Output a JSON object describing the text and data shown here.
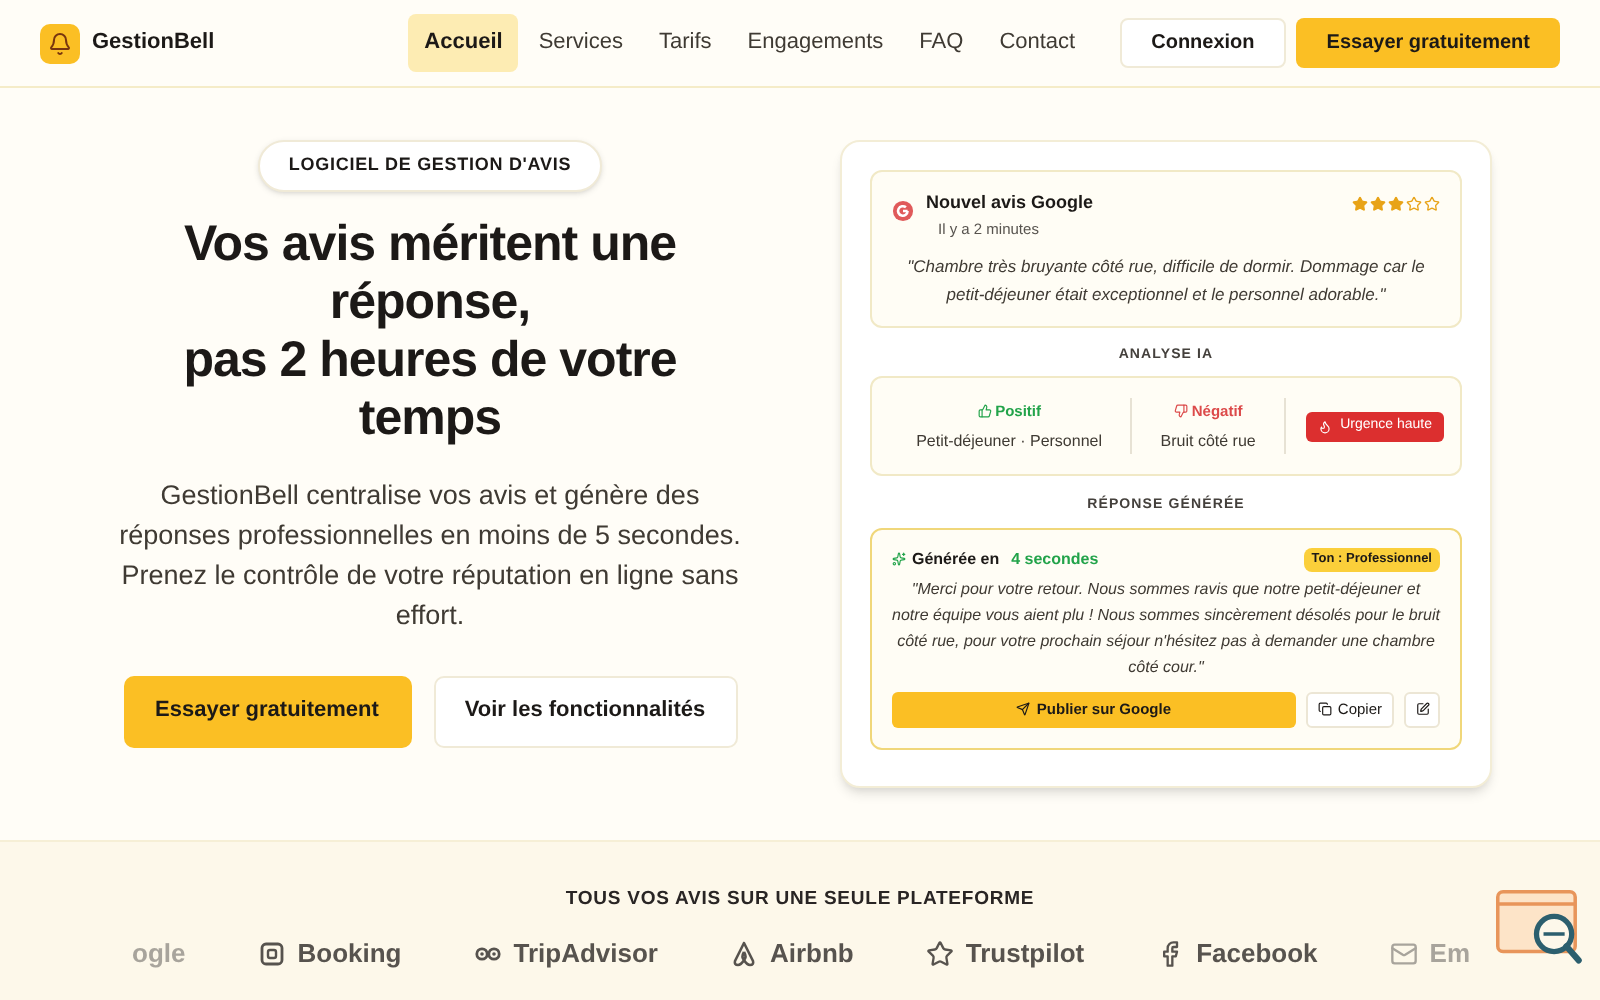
{
  "nav": {
    "brand": "GestionBell",
    "links": [
      {
        "label": "Accueil",
        "selected": true
      },
      {
        "label": "Services",
        "selected": false
      },
      {
        "label": "Tarifs",
        "selected": false
      },
      {
        "label": "Engagements",
        "selected": false
      },
      {
        "label": "FAQ",
        "selected": false
      },
      {
        "label": "Contact",
        "selected": false
      }
    ],
    "login": "Connexion",
    "cta": "Essayer gratuitement"
  },
  "hero": {
    "badge": "LOGICIEL DE GESTION D'AVIS",
    "title_lines": [
      "Vos avis méritent une réponse,",
      "pas 2 heures de votre temps"
    ],
    "text": "GestionBell centralise vos avis et génère des réponses professionnelles en moins de 5 secondes. Prenez le contrôle de votre réputation en ligne sans effort.",
    "primary": "Essayer gratuitement",
    "secondary": "Voir les fonctionnalités"
  },
  "demo": {
    "review": {
      "title": "Nouvel avis Google",
      "time": "Il y a 2 minutes",
      "stars": 3,
      "text": "\"Chambre très bruyante côté rue, difficile de dormir. Dommage car le petit-déjeuner était exceptionnel et le personnel adorable.\""
    },
    "analysis_title": "ANALYSE IA",
    "analysis": {
      "positive_label": "Positif",
      "positive": "Petit-déjeuner · Personnel",
      "negative_label": "Négatif",
      "negative": "Bruit côté rue",
      "urgency": "Urgence haute"
    },
    "response_title": "RÉPONSE GÉNÉRÉE",
    "response": {
      "generated": "Générée en",
      "duration": "4 secondes",
      "tone": "Ton : Professionnel",
      "text": "\"Merci pour votre retour. Nous sommes ravis que notre petit-déjeuner et notre équipe vous aient plu ! Nous sommes sincèrement désolés pour le bruit côté rue, pour votre prochain séjour n'hésitez pas à demander une chambre côté cour.\"",
      "publish": "Publier sur Google",
      "copy": "Copier"
    }
  },
  "platforms": {
    "title": "TOUS VOS AVIS SUR UNE SEULE PLATEFORME",
    "items": [
      {
        "kind": "google",
        "label": "ogle",
        "faded": true
      },
      {
        "kind": "booking",
        "label": "Booking",
        "faded": false
      },
      {
        "kind": "tripadvisor",
        "label": "TripAdvisor",
        "faded": false
      },
      {
        "kind": "airbnb",
        "label": "Airbnb",
        "faded": false
      },
      {
        "kind": "trustpilot",
        "label": "Trustpilot",
        "faded": false
      },
      {
        "kind": "facebook",
        "label": "Facebook",
        "faded": false
      },
      {
        "kind": "email",
        "label": "Em",
        "faded": true
      }
    ]
  }
}
